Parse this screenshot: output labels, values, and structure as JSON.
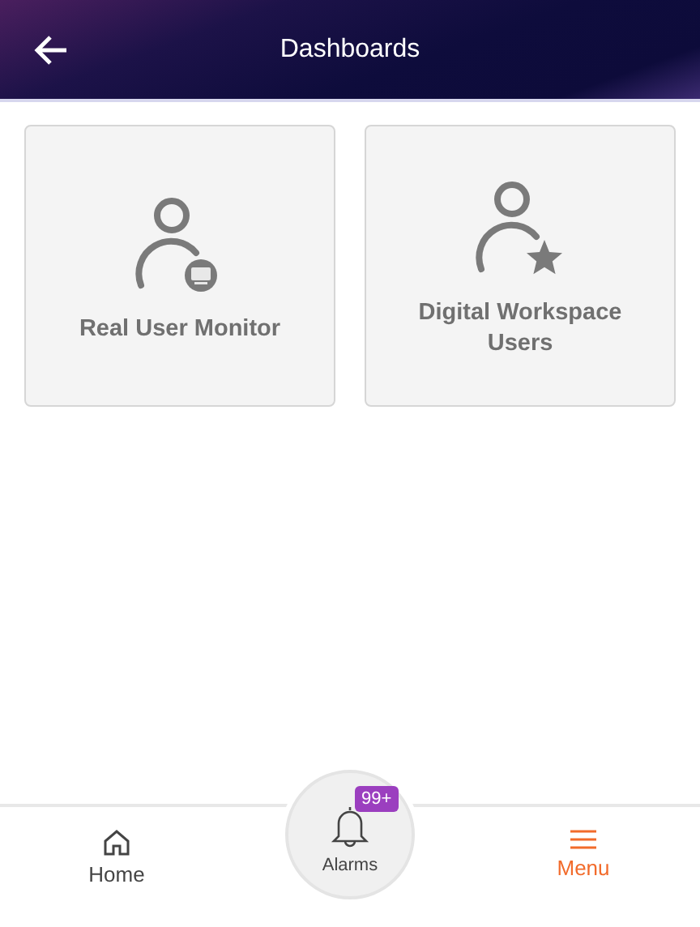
{
  "header": {
    "title": "Dashboards"
  },
  "dashboards": [
    {
      "kind": "monitor",
      "label": "Real User Monitor"
    },
    {
      "kind": "star",
      "label": "Digital Workspace Users"
    }
  ],
  "nav": [
    {
      "kind": "home",
      "label": "Home",
      "selected": false
    },
    {
      "kind": "alarms",
      "label": "Alarms",
      "badge": "99+",
      "selected": false
    },
    {
      "kind": "menu",
      "label": "Menu",
      "selected": true
    }
  ]
}
